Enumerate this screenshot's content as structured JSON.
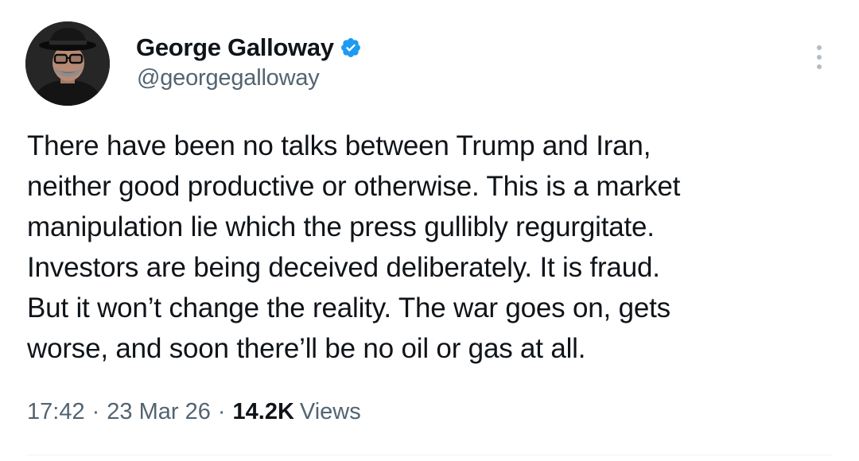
{
  "author": {
    "display_name": "George Galloway",
    "handle": "@georgegalloway",
    "verified": true
  },
  "tweet": {
    "lines": [
      "There have been no talks between Trump and Iran,",
      "neither good productive or otherwise. This is a market",
      "manipulation lie which the press gullibly regurgitate.",
      "Investors are being deceived deliberately. It is fraud.",
      "But it won’t change the reality. The war goes on, gets",
      "worse, and soon there’ll be no oil or gas at all."
    ]
  },
  "meta": {
    "time": "17:42",
    "separator": "·",
    "date": "23 Mar 26",
    "views_count": "14.2K",
    "views_label": "Views"
  },
  "icons": {
    "verified": "verified-badge-icon",
    "more": "more-options-icon"
  },
  "colors": {
    "text": "#0f1419",
    "secondary": "#536471",
    "verified_blue": "#1d9bf0",
    "more_dots": "#b3bcc4"
  }
}
